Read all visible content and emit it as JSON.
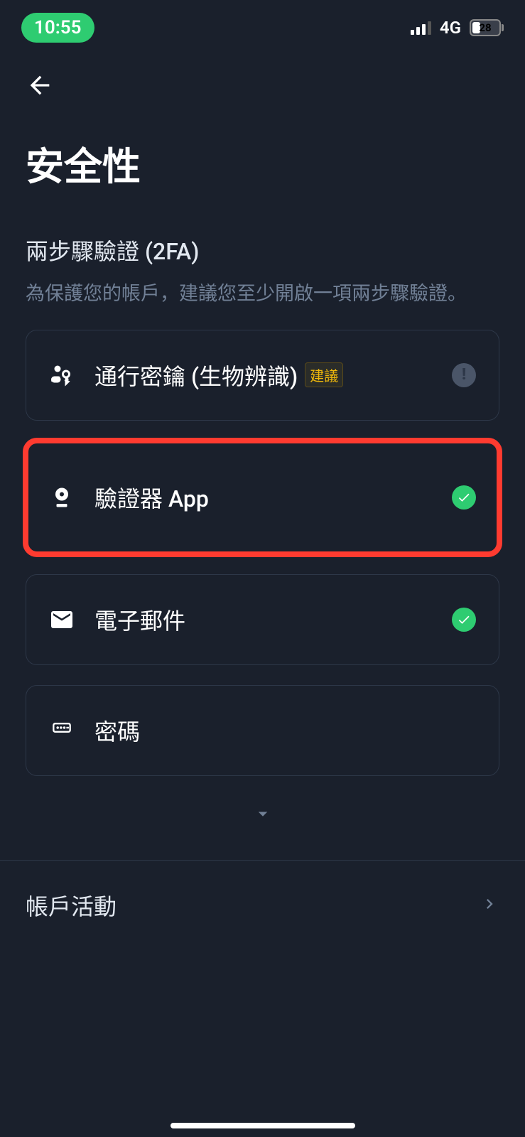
{
  "status_bar": {
    "time": "10:55",
    "network": "4G",
    "battery": "28"
  },
  "page": {
    "title": "安全性"
  },
  "twofa": {
    "title": "兩步驟驗證 (2FA)",
    "desc": "為保護您的帳戶，建議您至少開啟一項兩步驟驗證。",
    "options": {
      "passkey": {
        "label": "通行密鑰 (生物辨識)",
        "badge": "建議"
      },
      "authenticator": {
        "label": "驗證器 App"
      },
      "email": {
        "label": "電子郵件"
      },
      "password": {
        "label": "密碼"
      }
    }
  },
  "rows": {
    "account_activity": "帳戶活動"
  }
}
